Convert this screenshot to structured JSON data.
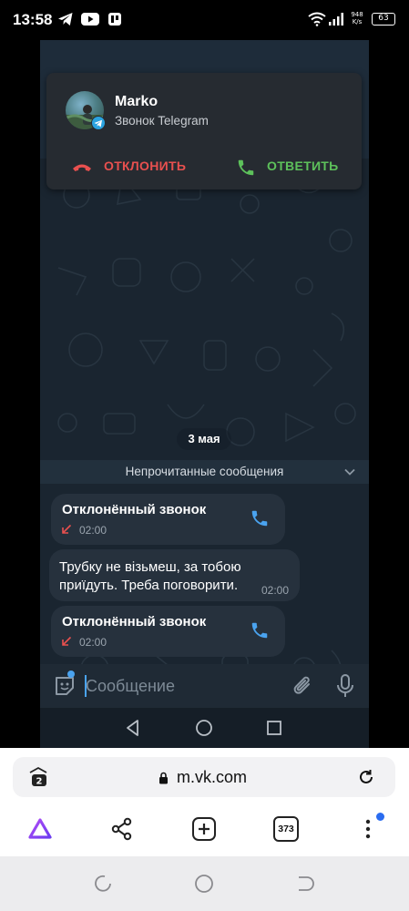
{
  "status_bar": {
    "time": "13:58",
    "net_speed_value": "948",
    "net_speed_unit": "K/s",
    "battery": "63",
    "icons": [
      "telegram-icon",
      "youtube-icon",
      "app-icon",
      "wifi-icon",
      "signal-icon",
      "signal-icon-2",
      "battery-icon"
    ]
  },
  "notification": {
    "caller": "Marko",
    "subtitle": "Звонок Telegram",
    "decline_label": "ОТКЛОНИТЬ",
    "answer_label": "ОТВЕТИТЬ",
    "decline_color": "#e8504f",
    "answer_color": "#5dc15b"
  },
  "chat": {
    "date_chip": "3 мая",
    "unread_label": "Непрочитанные сообщения",
    "messages": [
      {
        "type": "call",
        "title": "Отклонённый звонок",
        "time": "02:00"
      },
      {
        "type": "text",
        "text": "Трубку не візьмеш, за тобою приїдуть. Треба поговорити.",
        "time": "02:00"
      },
      {
        "type": "call",
        "title": "Отклонённый звонок",
        "time": "02:00"
      }
    ],
    "input_placeholder": "Сообщение",
    "accent_color": "#4aa3ef"
  },
  "browser": {
    "url": "m.vk.com",
    "tabs_count_small": "2",
    "tabs_count": "373"
  }
}
